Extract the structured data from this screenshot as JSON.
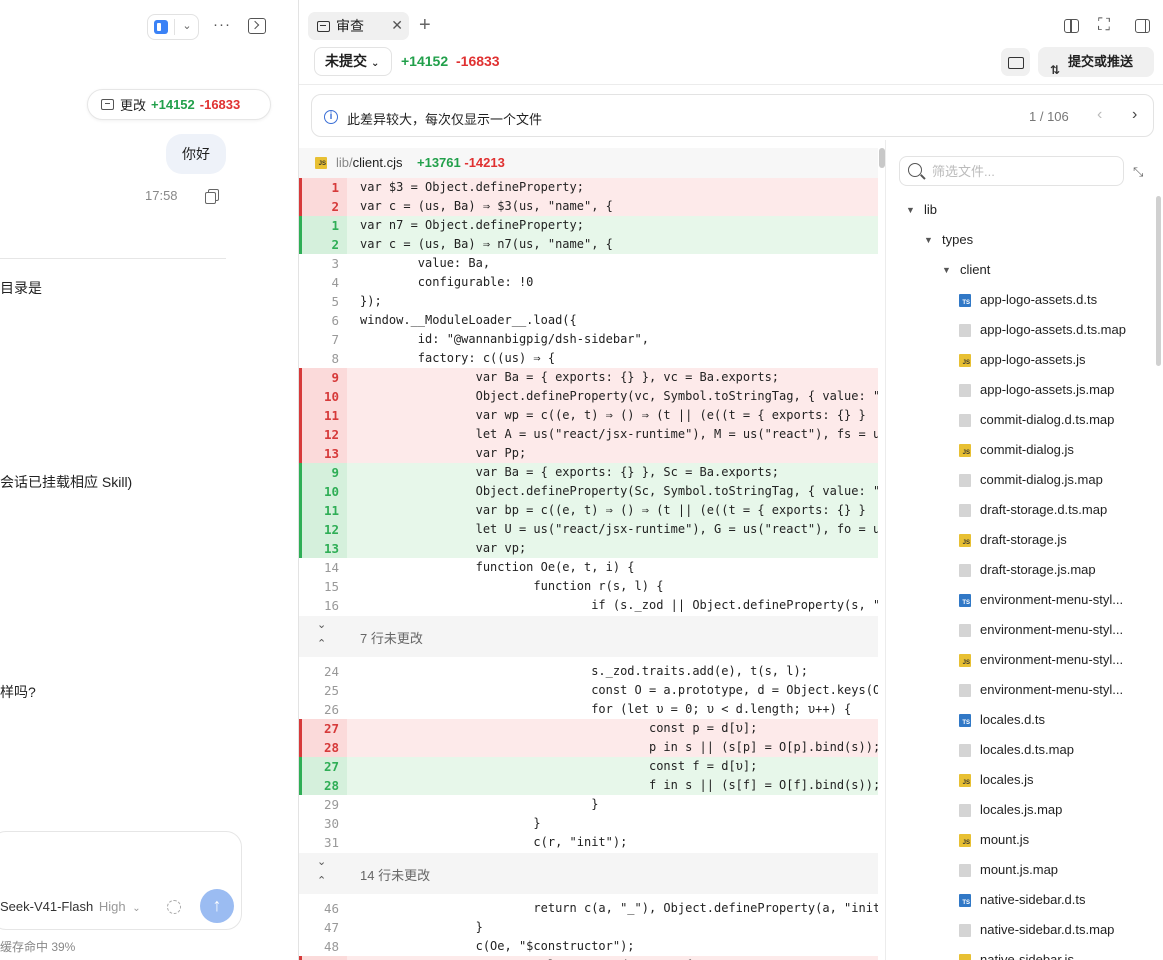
{
  "left": {
    "change_label": "更改",
    "change_plus": "+14152",
    "change_minus": "-16833",
    "user_message": "你好",
    "message_time": "17:58",
    "snippets": [
      "目录是",
      "会话已挂载相应 Skill)",
      "样吗?"
    ],
    "model_name": "Seek-V41-Flash",
    "model_level": "High",
    "cache_status": "缓存命中 39%"
  },
  "review": {
    "tab_label": "审查",
    "commit_scope": "未提交",
    "plus": "+14152",
    "minus": "-16833",
    "commit_push_label": "提交或推送",
    "notice": "此差异较大，每次仅显示一个文件",
    "page": "1 / 106"
  },
  "diff": {
    "file_dir": "lib/",
    "file_name": "client.cjs",
    "plus": "+13761",
    "minus": "-14213",
    "lines": [
      {
        "t": "del",
        "n": "1",
        "c": "var $3 = Object.defineProperty;"
      },
      {
        "t": "del",
        "n": "2",
        "c": "var c = (us, Ba) ⇒ $3(us, \"name\", {"
      },
      {
        "t": "add",
        "n": "1",
        "c": "var n7 = Object.defineProperty;"
      },
      {
        "t": "add",
        "n": "2",
        "c": "var c = (us, Ba) ⇒ n7(us, \"name\", {"
      },
      {
        "t": "ctx",
        "n": "3",
        "c": "        value: Ba,"
      },
      {
        "t": "ctx",
        "n": "4",
        "c": "        configurable: !0"
      },
      {
        "t": "ctx",
        "n": "5",
        "c": "});"
      },
      {
        "t": "ctx",
        "n": "6",
        "c": "window.__ModuleLoader__.load({"
      },
      {
        "t": "ctx",
        "n": "7",
        "c": "        id: \"@wannanbigpig/dsh-sidebar\","
      },
      {
        "t": "ctx",
        "n": "8",
        "c": "        factory: c((us) ⇒ {"
      },
      {
        "t": "del",
        "n": "9",
        "c": "                var Ba = { exports: {} }, vc = Ba.exports;"
      },
      {
        "t": "del",
        "n": "10",
        "c": "                Object.defineProperty(vc, Symbol.toStringTag, { value: \""
      },
      {
        "t": "del",
        "n": "11",
        "c": "                var wp = c((e, t) ⇒ () ⇒ (t || (e((t = { exports: {} }"
      },
      {
        "t": "del",
        "n": "12",
        "c": "                let A = us(\"react/jsx-runtime\"), M = us(\"react\"), fs = u"
      },
      {
        "t": "del",
        "n": "13",
        "c": "                var Pp;"
      },
      {
        "t": "add",
        "n": "9",
        "c": "                var Ba = { exports: {} }, Sc = Ba.exports;"
      },
      {
        "t": "add",
        "n": "10",
        "c": "                Object.defineProperty(Sc, Symbol.toStringTag, { value: \""
      },
      {
        "t": "add",
        "n": "11",
        "c": "                var bp = c((e, t) ⇒ () ⇒ (t || (e((t = { exports: {} }"
      },
      {
        "t": "add",
        "n": "12",
        "c": "                let U = us(\"react/jsx-runtime\"), G = us(\"react\"), fo = u"
      },
      {
        "t": "add",
        "n": "13",
        "c": "                var vp;"
      },
      {
        "t": "ctx",
        "n": "14",
        "c": "                function Oe(e, t, i) {"
      },
      {
        "t": "ctx",
        "n": "15",
        "c": "                        function r(s, l) {"
      },
      {
        "t": "ctx",
        "n": "16",
        "c": "                                if (s._zod || Object.defineProperty(s, \""
      },
      {
        "t": "fold",
        "label": "7 行未更改"
      },
      {
        "t": "ctx",
        "n": "24",
        "c": "                                s._zod.traits.add(e), t(s, l);"
      },
      {
        "t": "ctx",
        "n": "25",
        "c": "                                const O = a.prototype, d = Object.keys(O"
      },
      {
        "t": "ctx",
        "n": "26",
        "c": "                                for (let υ = 0; υ < d.length; υ++) {"
      },
      {
        "t": "del",
        "n": "27",
        "c": "                                        const p = d[υ];"
      },
      {
        "t": "del",
        "n": "28",
        "c": "                                        p in s || (s[p] = O[p].bind(s));"
      },
      {
        "t": "add",
        "n": "27",
        "c": "                                        const f = d[υ];"
      },
      {
        "t": "add",
        "n": "28",
        "c": "                                        f in s || (s[f] = O[f].bind(s));"
      },
      {
        "t": "ctx",
        "n": "29",
        "c": "                                }"
      },
      {
        "t": "ctx",
        "n": "30",
        "c": "                        }"
      },
      {
        "t": "ctx",
        "n": "31",
        "c": "                        c(r, \"init\");"
      },
      {
        "t": "fold",
        "label": "14 行未更改"
      },
      {
        "t": "ctx",
        "n": "46",
        "c": "                        return c(a, \"_\"), Object.defineProperty(a, \"init"
      },
      {
        "t": "ctx",
        "n": "47",
        "c": "                }"
      },
      {
        "t": "ctx",
        "n": "48",
        "c": "                c(Oe, \"$constructor\");"
      },
      {
        "t": "del",
        "n": "49",
        "c": "                var ps = class extends Error {"
      }
    ]
  },
  "tree": {
    "filter_placeholder": "筛选文件...",
    "folders": [
      "lib",
      "types",
      "client"
    ],
    "files": [
      {
        "name": "app-logo-assets.d.ts",
        "icon": "ts"
      },
      {
        "name": "app-logo-assets.d.ts.map",
        "icon": "map"
      },
      {
        "name": "app-logo-assets.js",
        "icon": "js"
      },
      {
        "name": "app-logo-assets.js.map",
        "icon": "map"
      },
      {
        "name": "commit-dialog.d.ts.map",
        "icon": "map"
      },
      {
        "name": "commit-dialog.js",
        "icon": "js"
      },
      {
        "name": "commit-dialog.js.map",
        "icon": "map"
      },
      {
        "name": "draft-storage.d.ts.map",
        "icon": "map"
      },
      {
        "name": "draft-storage.js",
        "icon": "js"
      },
      {
        "name": "draft-storage.js.map",
        "icon": "map"
      },
      {
        "name": "environment-menu-styl...",
        "icon": "ts"
      },
      {
        "name": "environment-menu-styl...",
        "icon": "map"
      },
      {
        "name": "environment-menu-styl...",
        "icon": "js"
      },
      {
        "name": "environment-menu-styl...",
        "icon": "map"
      },
      {
        "name": "locales.d.ts",
        "icon": "ts"
      },
      {
        "name": "locales.d.ts.map",
        "icon": "map"
      },
      {
        "name": "locales.js",
        "icon": "js"
      },
      {
        "name": "locales.js.map",
        "icon": "map"
      },
      {
        "name": "mount.js",
        "icon": "js"
      },
      {
        "name": "mount.js.map",
        "icon": "map"
      },
      {
        "name": "native-sidebar.d.ts",
        "icon": "ts"
      },
      {
        "name": "native-sidebar.d.ts.map",
        "icon": "map"
      },
      {
        "name": "native-sidebar.js",
        "icon": "js"
      }
    ]
  }
}
